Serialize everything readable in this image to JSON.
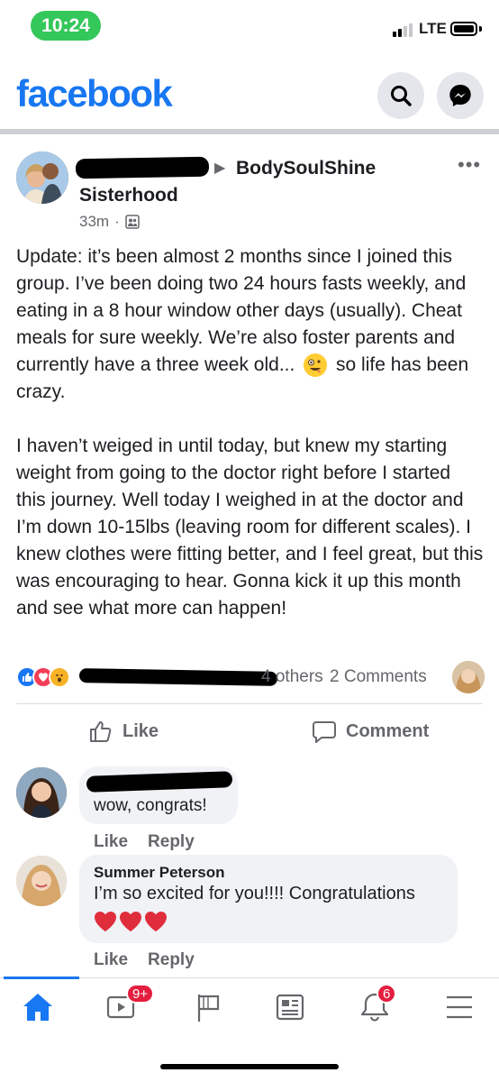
{
  "status_bar": {
    "time": "10:24",
    "network": "LTE"
  },
  "header": {
    "logo": "facebook",
    "search_icon": "search-icon",
    "messenger_icon": "messenger-icon"
  },
  "post": {
    "group": "BodySoulShine",
    "group_line2": "Sisterhood",
    "time": "33m",
    "audience_icon": "group-members-icon",
    "body": [
      "Update: it’s been almost 2 months since I joined this group. I’ve been doing two 24 hours fasts weekly, and eating in a 8 hour window other days (usually). Cheat meals for sure weekly. We’re also foster parents and currently have a three week old...",
      "so life has been crazy.",
      "I haven’t weiged in until today, but knew my starting weight from going to the doctor right before I started this journey. Well today I weighed in at the doctor and I’m down 10-15lbs (leaving room for different scales). I knew clothes were fitting better, and I feel great, but this was encouraging to hear. Gonna kick it up this month and see what more can happen!"
    ],
    "reactions_others": "4 others",
    "comments_count": "2 Comments",
    "like_label": "Like",
    "comment_label": "Comment"
  },
  "comments": [
    {
      "name": "",
      "text": "wow, congrats!",
      "like": "Like",
      "reply": "Reply"
    },
    {
      "name": "Summer Peterson",
      "text": "I’m so excited for you!!!! Congratulations",
      "like": "Like",
      "reply": "Reply"
    }
  ],
  "tabbar": {
    "watch_badge": "9+",
    "notifications_badge": "6"
  },
  "colors": {
    "brand": "#1877f2",
    "badge": "#e41e3f",
    "time_pill": "#34c759"
  }
}
